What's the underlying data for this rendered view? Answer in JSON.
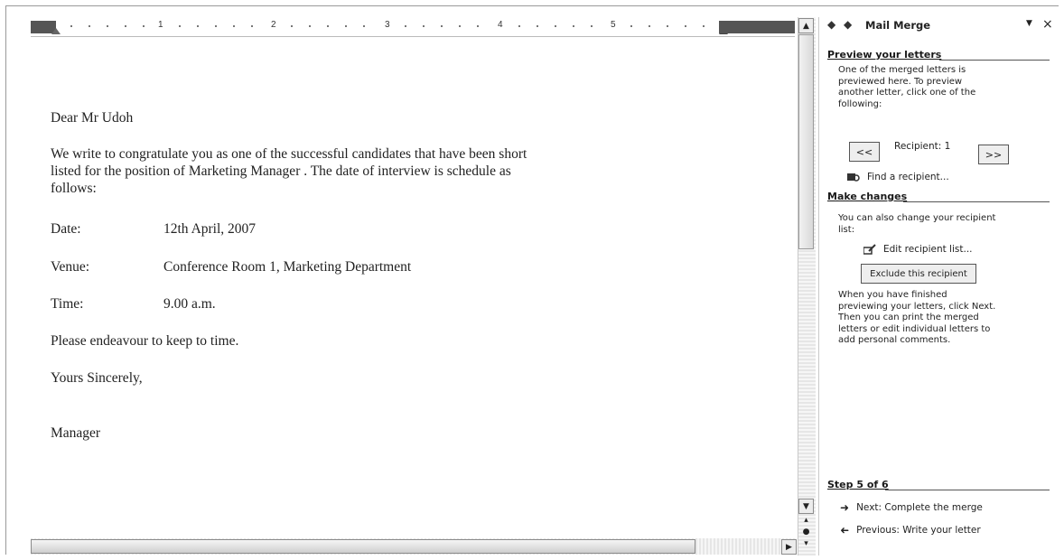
{
  "ruler": {
    "marks": [
      "1",
      "2",
      "3",
      "4",
      "5"
    ]
  },
  "letter": {
    "salutation": "Dear Mr Udoh",
    "body_line1": "We write to congratulate you as one of the successful candidates that have been short",
    "body_line2": "listed for the position of  Marketing Manager . The date of interview is schedule as",
    "body_line3": "follows:",
    "date_label": "Date:",
    "date_value": "12th April, 2007",
    "venue_label": "Venue:",
    "venue_value": "Conference Room 1, Marketing Department",
    "time_label": "Time:",
    "time_value": "9.00 a.m.",
    "closing_note": "Please endeavour to keep to time.",
    "signoff": "Yours Sincerely,",
    "signature": "Manager"
  },
  "task_pane": {
    "title": "Mail Merge",
    "preview_heading": "Preview your letters",
    "preview_text": [
      "One of the merged letters is",
      "previewed here. To preview",
      "another letter, click one of the",
      "following:"
    ],
    "prev_button": "<<",
    "recipient_label": "Recipient: 1",
    "next_button": ">>",
    "find_recipient": "Find a recipient...",
    "changes_heading": "Make changes",
    "changes_text": [
      "You can also change your recipient",
      "list:"
    ],
    "edit_list": "Edit recipient list...",
    "exclude_button": "Exclude this recipient",
    "finish_text": [
      "When you have finished",
      "previewing your letters, click Next.",
      "Then you can print the merged",
      "letters or edit individual letters to",
      "add personal comments."
    ],
    "step_heading": "Step 5 of 6",
    "next_step": "Next: Complete the merge",
    "prev_step": "Previous: Write your letter"
  }
}
